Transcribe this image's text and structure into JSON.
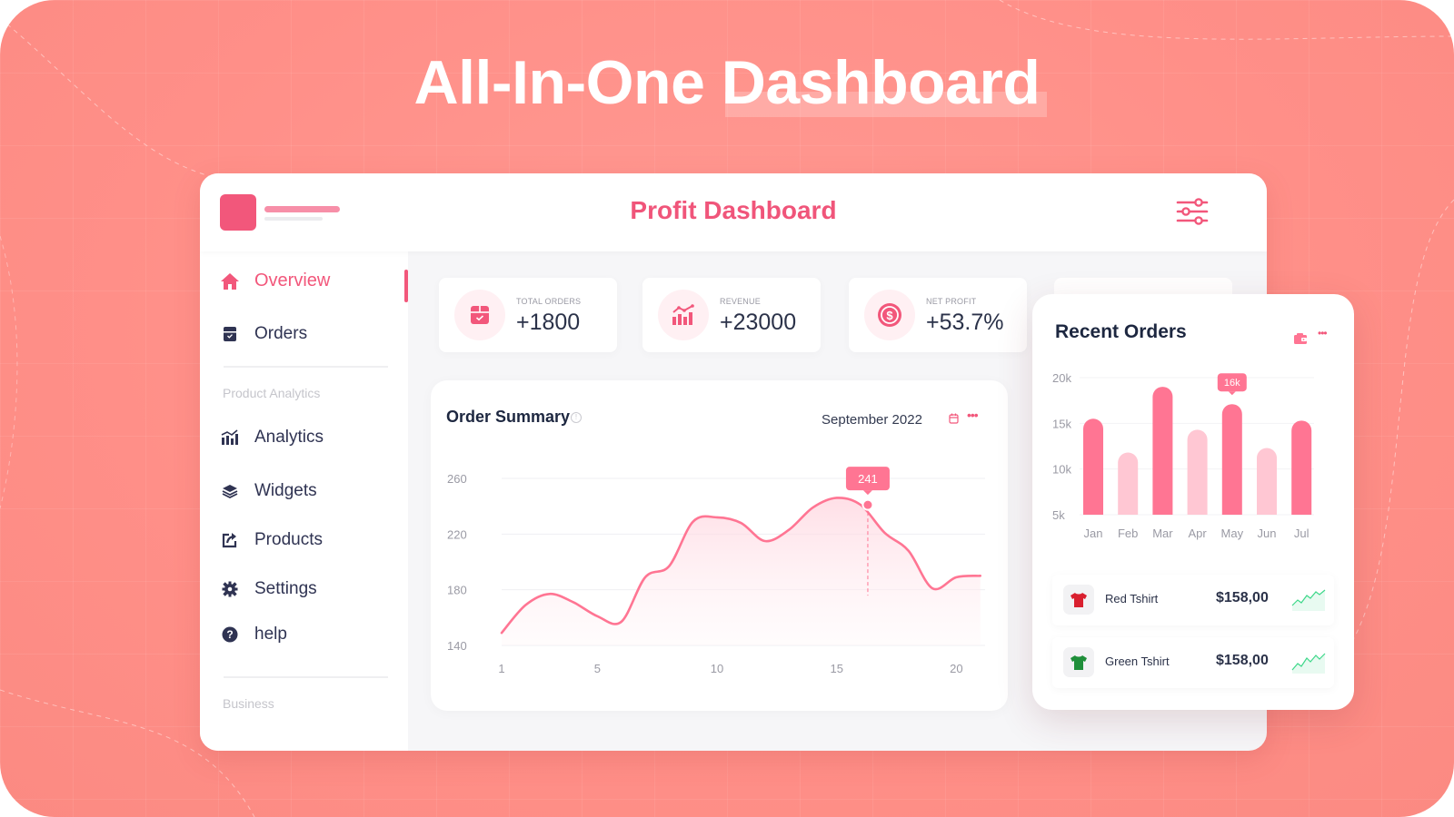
{
  "hero": {
    "title": "All-In-One Dashboard"
  },
  "app": {
    "title": "Profit Dashboard",
    "filter_icon": "sliders-icon"
  },
  "sidebar": {
    "items": [
      {
        "label": "Overview",
        "icon": "home-icon",
        "active": true
      },
      {
        "label": "Orders",
        "icon": "box-icon",
        "active": false
      },
      {
        "label": "Analytics",
        "icon": "bar-chart-icon",
        "active": false
      },
      {
        "label": "Widgets",
        "icon": "layers-icon",
        "active": false
      },
      {
        "label": "Products",
        "icon": "share-icon",
        "active": false
      },
      {
        "label": "Settings",
        "icon": "gear-icon",
        "active": false
      },
      {
        "label": "help",
        "icon": "help-icon",
        "active": false
      }
    ],
    "sections": {
      "product_analytics": "Product Analytics",
      "business": "Business"
    }
  },
  "stats": [
    {
      "label": "TOTAL ORDERS",
      "value": "+1800",
      "icon": "box-icon"
    },
    {
      "label": "REVENUE",
      "value": "+23000",
      "icon": "chart-icon"
    },
    {
      "label": "NET PROFIT",
      "value": "+53.7%",
      "icon": "dollar-icon"
    }
  ],
  "order_summary": {
    "title": "Order Summary",
    "date": "September 2022",
    "tooltip": "241"
  },
  "recent_orders": {
    "title": "Recent Orders",
    "tooltip": "16k",
    "items": [
      {
        "name": "Red Tshirt",
        "price": "$158,00",
        "color": "#d9202f"
      },
      {
        "name": "Green Tshirt",
        "price": "$158,00",
        "color": "#1f8f3a"
      }
    ]
  },
  "colors": {
    "accent": "#f2577b",
    "bar_strong": "#ff7593",
    "bar_light": "#ffc7d3",
    "spark": "#3ed88a"
  },
  "chart_data": [
    {
      "type": "line",
      "title": "Order Summary",
      "x": [
        1,
        2,
        3,
        4,
        5,
        6,
        7,
        8,
        9,
        10,
        11,
        12,
        13,
        14,
        15,
        16,
        17,
        18,
        19,
        20,
        21
      ],
      "series": [
        {
          "name": "Orders",
          "values": [
            149,
            169,
            177,
            171,
            161,
            157,
            189,
            197,
            229,
            232,
            228,
            215,
            223,
            239,
            246,
            241,
            221,
            208,
            181,
            189,
            190
          ]
        }
      ],
      "xticks": [
        "1",
        "5",
        "10",
        "15",
        "20"
      ],
      "xtick_values": [
        1,
        5,
        10,
        15,
        20
      ],
      "yticks": [
        "140",
        "180",
        "220",
        "260"
      ],
      "ytick_values": [
        140,
        180,
        220,
        260
      ],
      "ylim": [
        140,
        260
      ],
      "xlim": [
        1,
        21.2
      ],
      "highlight": {
        "x": 16.3,
        "y": 241,
        "label": "241"
      },
      "grid": true
    },
    {
      "type": "bar",
      "title": "Recent Orders",
      "categories": [
        "Jan",
        "Feb",
        "Mar",
        "Apr",
        "May",
        "Jun",
        "Jul"
      ],
      "values": [
        15.5,
        11.8,
        19,
        14.3,
        17.1,
        12.3,
        15.3
      ],
      "emphasis": [
        true,
        false,
        true,
        false,
        true,
        false,
        true
      ],
      "yticks": [
        "5k",
        "10k",
        "15k",
        "20k"
      ],
      "ytick_values": [
        5,
        10,
        15,
        20
      ],
      "ylim": [
        5,
        20
      ],
      "unit": "k",
      "highlight": {
        "category": "May",
        "label": "16k"
      },
      "grid": true
    }
  ]
}
